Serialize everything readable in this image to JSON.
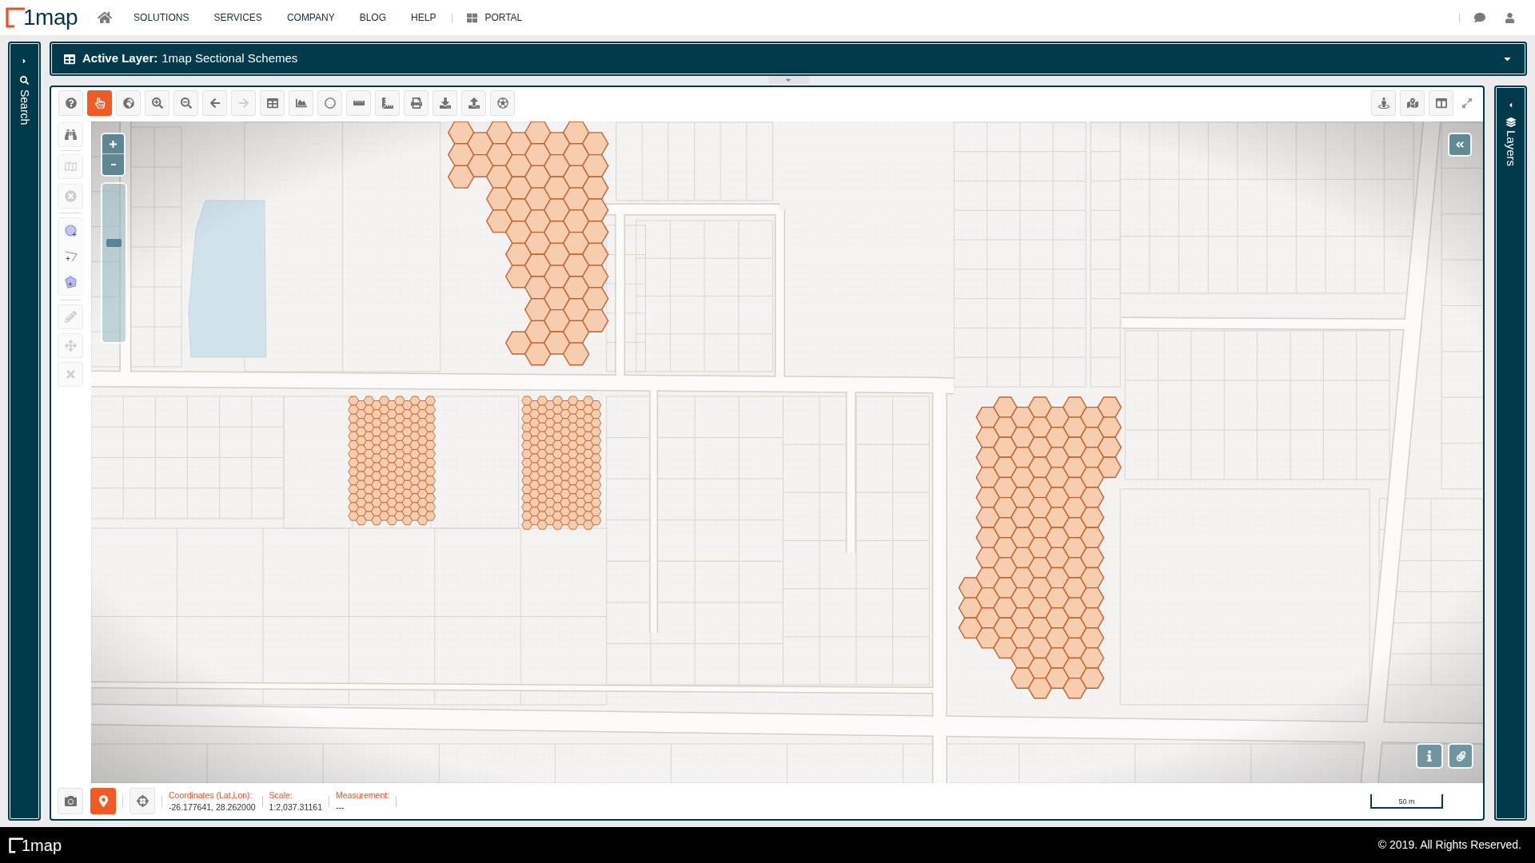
{
  "nav": {
    "logo": "1map",
    "links": [
      {
        "label": "SOLUTIONS"
      },
      {
        "label": "SERVICES"
      },
      {
        "label": "COMPANY"
      },
      {
        "label": "BLOG"
      },
      {
        "label": "HELP"
      }
    ],
    "portal": "PORTAL"
  },
  "left_sidebar": {
    "label": "Search"
  },
  "active_layer": {
    "label": "Active Layer:",
    "name": "1map Sectional Schemes"
  },
  "toolbar": {
    "tools": [
      {
        "selected": false,
        "disabled": false
      },
      {
        "selected": true,
        "disabled": false
      },
      {
        "selected": false,
        "disabled": false
      },
      {
        "selected": false,
        "disabled": false
      },
      {
        "selected": false,
        "disabled": false
      },
      {
        "selected": false,
        "disabled": false
      },
      {
        "selected": false,
        "disabled": true
      },
      {
        "selected": false,
        "disabled": false
      },
      {
        "selected": false,
        "disabled": false
      },
      {
        "selected": false,
        "disabled": false
      },
      {
        "selected": false,
        "disabled": false
      },
      {
        "selected": false,
        "disabled": false
      },
      {
        "selected": false,
        "disabled": false
      },
      {
        "selected": false,
        "disabled": false
      },
      {
        "selected": false,
        "disabled": false
      },
      {
        "selected": false,
        "disabled": false
      }
    ]
  },
  "side_tools": [
    {
      "disabled": false
    },
    {
      "disabled": true
    },
    {
      "disabled": true
    },
    {
      "disabled": false
    },
    {
      "disabled": false
    },
    {
      "disabled": false
    },
    {
      "disabled": true
    },
    {
      "disabled": true
    },
    {
      "disabled": true
    }
  ],
  "map": {
    "zoom": {
      "level": 0.64
    }
  },
  "status_bar": {
    "tools": [
      {
        "selected": false
      },
      {
        "selected": true
      },
      {
        "selected": false
      }
    ],
    "fields": [
      {
        "label": "Coordinates (Lat,Lon):",
        "value": "-26.177641, 28.262000"
      },
      {
        "label": "Scale:",
        "value": "1:2,037.31161"
      },
      {
        "label": "Measurement:",
        "value": "---"
      }
    ],
    "scale_bar": "50 m"
  },
  "right_sidebar": {
    "label": "Layers"
  },
  "footer": {
    "logo": "1map",
    "copyright": "© 2019. All Rights Reserved."
  }
}
